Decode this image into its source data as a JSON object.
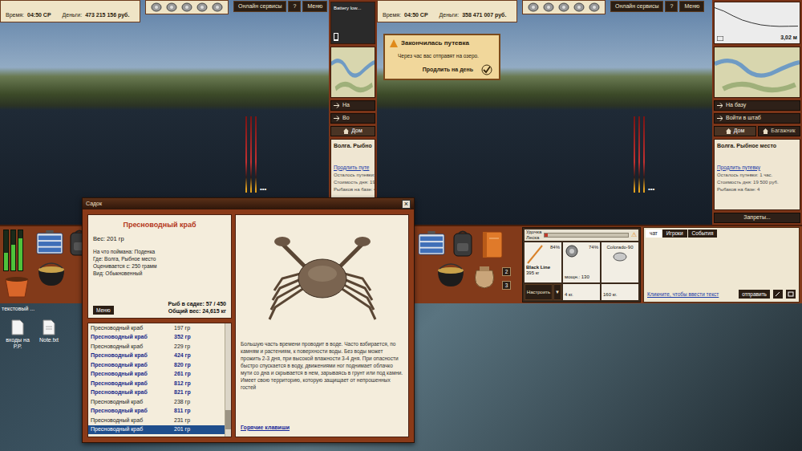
{
  "desktop": {
    "icons": [
      {
        "label": "текстовый ..."
      },
      {
        "label": "входы на Р.Р."
      },
      {
        "label": "Note.txt"
      }
    ]
  },
  "left_window": {
    "hud": {
      "time_label": "Время:",
      "time": "04:50 СР",
      "money_label": "Деньги:",
      "money": "473 215 156 руб."
    },
    "buttons": [
      "Онлайн сервисы",
      "?",
      "Меню"
    ],
    "battery": {
      "text": "Battery low...",
      "level": 0.1
    },
    "nav": [
      "На",
      "Во"
    ],
    "tabs": [
      {
        "label": "Дом",
        "selected": true
      }
    ],
    "location": "Волга. Рыбно",
    "extend_link": "Продлить путе",
    "info": [
      "Осталось путевки:",
      "Стоимость дня: 19",
      "Рыбаков на базе: 4"
    ],
    "rods_more": "•••",
    "meter": {
      "levels": [
        0.45,
        0.65,
        0.8
      ]
    }
  },
  "right_window": {
    "hud": {
      "time_label": "Время:",
      "time": "04:50 СР",
      "money_label": "Деньги:",
      "money": "358 471 007 руб."
    },
    "buttons": [
      "Онлайн сервисы",
      "?",
      "Меню"
    ],
    "depth": {
      "reading": "3,02 м",
      "profile": [
        0.3,
        0.8,
        1.5,
        2.1,
        2.5,
        2.8,
        2.95,
        3.02,
        3.0,
        2.98
      ]
    },
    "nav": [
      "На базу",
      "Войти в штаб"
    ],
    "tabs": [
      {
        "label": "Дом",
        "selected": true
      },
      {
        "label": "Багажник",
        "selected": false
      }
    ],
    "location": "Волга. Рыбное место",
    "extend_link": "Продлить путевку",
    "info": [
      "Осталось путевки: 1 час.",
      "Стоимость дня: 19 500 руб.",
      "Рыбаков на базе: 4"
    ],
    "bans": "Запреты...",
    "rods_more": "•••",
    "popup": {
      "title": "Закончилась путевка",
      "text": "Через час вас отправят на озеро.",
      "action": "Продлить на день"
    },
    "slots": [
      "2",
      "3"
    ],
    "rig": {
      "rod_label": "Удочка",
      "line_label": "Леска",
      "warning": "⚠",
      "tension": 0.04,
      "rod": {
        "name": "Black Line",
        "load": "395 кг",
        "wear": "84%"
      },
      "reel": {
        "power": "мощн.: 130",
        "wear": "74%"
      },
      "lure": "Colorado-90",
      "setup": "Настроить",
      "dropdown": "▼",
      "weights": [
        "4 кг.",
        "160 кг."
      ]
    },
    "chat": {
      "tabs": [
        {
          "label": "чат",
          "selected": true
        },
        {
          "label": "Игроки",
          "selected": false
        },
        {
          "label": "События",
          "selected": false
        }
      ],
      "placeholder": "Кликните, чтобы ввести текст",
      "send": "отправить"
    }
  },
  "keepnet": {
    "title": "Садок",
    "close": "×",
    "fish": {
      "name": "Пресноводный краб",
      "weight": "Вес: 201 гр",
      "details": [
        "На что поймана: Поденка",
        "Где: Волга, Рыбное место",
        "Оценивается с: 250 грамм",
        "Вид: Обыкновенный"
      ]
    },
    "menu": "Меню",
    "count": "Рыб в садке: 57 / 450",
    "total": "Общий вес: 24,615 кг",
    "rows": [
      {
        "name": "Пресноводный краб",
        "weight": "197 гр",
        "trophy": false,
        "selected": false
      },
      {
        "name": "Пресноводный краб",
        "weight": "352 гр",
        "trophy": true,
        "selected": false
      },
      {
        "name": "Пресноводный краб",
        "weight": "229 гр",
        "trophy": false,
        "selected": false
      },
      {
        "name": "Пресноводный краб",
        "weight": "424 гр",
        "trophy": true,
        "selected": false
      },
      {
        "name": "Пресноводный краб",
        "weight": "820 гр",
        "trophy": true,
        "selected": false
      },
      {
        "name": "Пресноводный краб",
        "weight": "261 гр",
        "trophy": true,
        "selected": false
      },
      {
        "name": "Пресноводный краб",
        "weight": "812 гр",
        "trophy": true,
        "selected": false
      },
      {
        "name": "Пресноводный краб",
        "weight": "821 гр",
        "trophy": true,
        "selected": false
      },
      {
        "name": "Пресноводный краб",
        "weight": "238 гр",
        "trophy": false,
        "selected": false
      },
      {
        "name": "Пресноводный краб",
        "weight": "811 гр",
        "trophy": true,
        "selected": false
      },
      {
        "name": "Пресноводный краб",
        "weight": "231 гр",
        "trophy": false,
        "selected": false
      },
      {
        "name": "Пресноводный краб",
        "weight": "201 гр",
        "trophy": false,
        "selected": true
      }
    ],
    "scroll": 0.92,
    "description": "Большую часть времени проводит в воде. Часто взбирается, по камням и растениям, к поверхности воды. Без воды может прожить 2-3 дня, при высокой влажности 3-4 дня. При опасности быстро спускается в воду, движениями ног поднимает облачко мути со дна и скрывается в нем, зарываясь в грунт или под камни. Имеет свою территорию, которую защищает от непрошенных гостей",
    "hotkeys": "Горячие клавиши"
  }
}
